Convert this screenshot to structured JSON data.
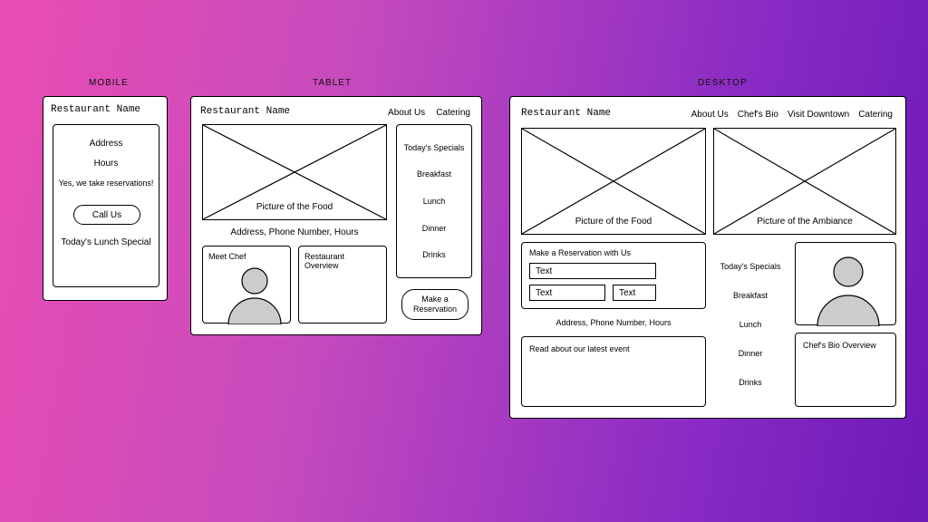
{
  "labels": {
    "mobile": "MOBILE",
    "tablet": "TABLET",
    "desktop": "DESKTOP"
  },
  "site_title": "Restaurant Name",
  "mobile": {
    "items": [
      "Address",
      "Hours",
      "Yes, we take reservations!"
    ],
    "call_us": "Call Us",
    "lunch_special": "Today's Lunch Special"
  },
  "tablet": {
    "nav": [
      "About Us",
      "Catering"
    ],
    "food_caption": "Picture of the Food",
    "address_line": "Address, Phone Number, Hours",
    "meet_chef": "Meet Chef",
    "restaurant_overview": "Restaurant Overview",
    "specials_title": "Today's Specials",
    "specials": [
      "Breakfast",
      "Lunch",
      "Dinner",
      "Drinks"
    ],
    "make_reservation": "Make a Reservation"
  },
  "desktop": {
    "nav": [
      "About Us",
      "Chef's Bio",
      "Visit Downtown",
      "Catering"
    ],
    "food_caption": "Picture of the Food",
    "ambiance_caption": "Picture of the Ambiance",
    "reservation_title": "Make a Reservation with Us",
    "field_placeholder": "Text",
    "address_line": "Address, Phone Number, Hours",
    "latest_event": "Read about our latest event",
    "specials_title": "Today's Specials",
    "specials": [
      "Breakfast",
      "Lunch",
      "Dinner",
      "Drinks"
    ],
    "chef_bio_overview": "Chef's Bio Overview"
  }
}
